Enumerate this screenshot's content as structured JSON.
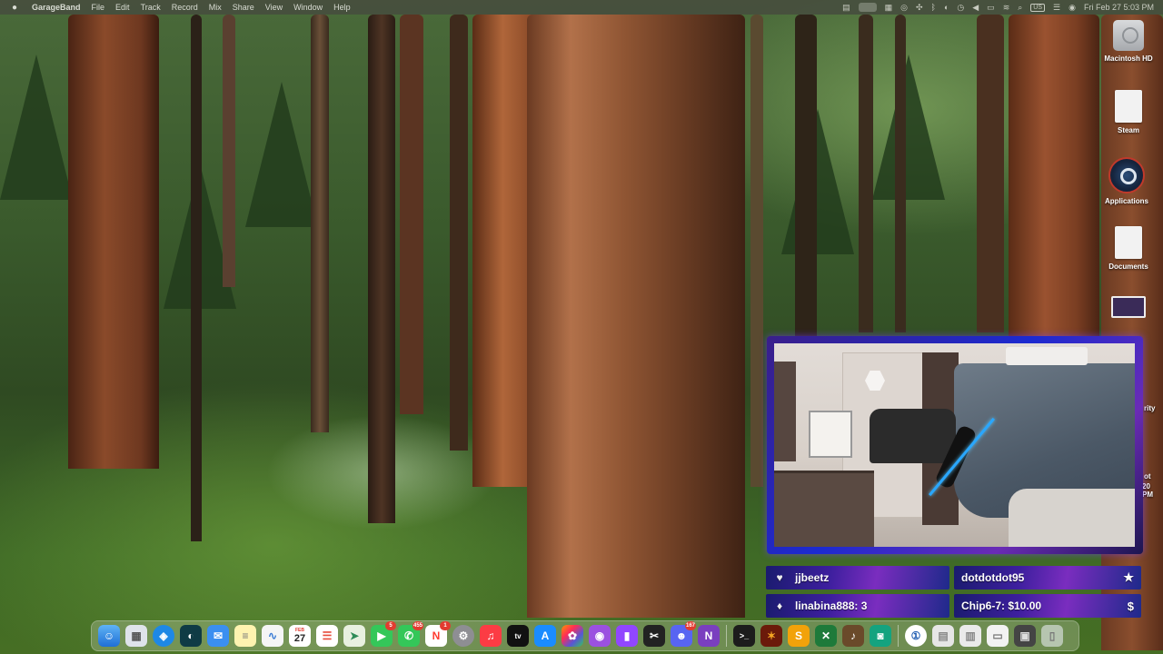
{
  "menubar": {
    "app_name": "GarageBand",
    "items": [
      "File",
      "Edit",
      "Track",
      "Record",
      "Mix",
      "Share",
      "View",
      "Window",
      "Help"
    ],
    "input_source": "US",
    "clock": "Fri Feb 27  5:03 PM"
  },
  "desktop_icons": [
    {
      "label": "Macintosh HD",
      "icon": "hard-drive-icon"
    },
    {
      "label": "Steam",
      "icon": "document-icon"
    },
    {
      "label": "Applications",
      "icon": "steam-icon"
    },
    {
      "label": "Documents",
      "icon": "document-icon"
    },
    {
      "label": "",
      "icon": "screenshot-icon"
    }
  ],
  "partial_labels": {
    "right1": "rity",
    "right2": "ot",
    "right3": "20 PM"
  },
  "alerts": [
    {
      "icon": "heart-icon",
      "glyph": "♥",
      "text": "jjbeetz"
    },
    {
      "text": "dotdotdot95",
      "icon": "star-icon",
      "glyph": "★"
    },
    {
      "icon": "diamond-icon",
      "glyph": "♦",
      "text": "linabina888: 3"
    },
    {
      "text": "Chip6-7: $10.00",
      "icon": "dollar-icon",
      "glyph": "$"
    }
  ],
  "dock": {
    "calendar_month": "FEB",
    "calendar_day": "27",
    "badges": {
      "facetime": "5",
      "messages": "455",
      "news": "1",
      "discord": "167"
    }
  },
  "colors": {
    "alert_gradient_start": "#1a1b6e",
    "alert_gradient_mid": "#7a2dbf",
    "webcam_border": "#3a1f8a"
  }
}
